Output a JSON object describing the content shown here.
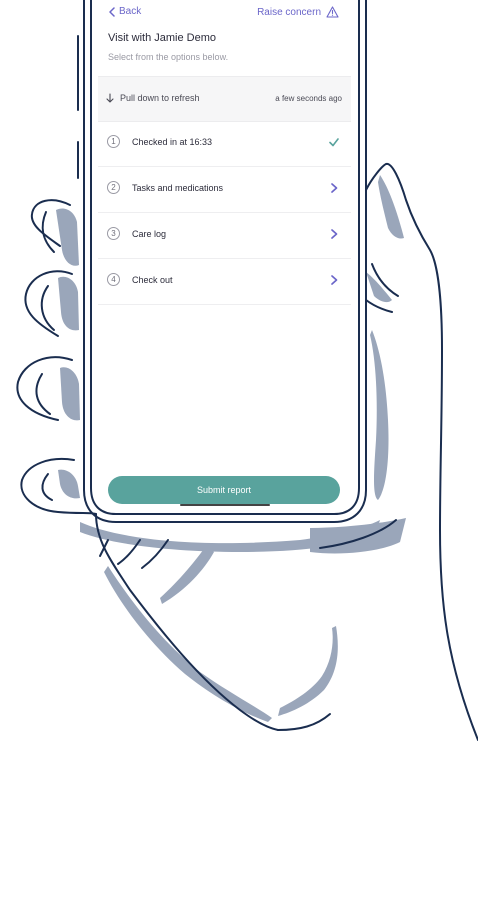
{
  "header": {
    "back_label": "Back",
    "raise_label": "Raise concern",
    "title": "Visit with Jamie Demo",
    "subtitle": "Select from the options below."
  },
  "refresh": {
    "label": "Pull down to refresh",
    "timestamp": "a few seconds ago"
  },
  "steps": [
    {
      "number": "1",
      "label": "Checked in at 16:33",
      "status": "check-icon"
    },
    {
      "number": "2",
      "label": "Tasks and medications",
      "status": "chevron-right-icon"
    },
    {
      "number": "3",
      "label": "Care log",
      "status": "chevron-right-icon"
    },
    {
      "number": "4",
      "label": "Check out",
      "status": "chevron-right-icon"
    }
  ],
  "submit_label": "Submit report",
  "colors": {
    "accent": "#6b66c9",
    "teal": "#59a39d",
    "outline": "#1a2d4f",
    "shadow": "#9aa6ba"
  }
}
